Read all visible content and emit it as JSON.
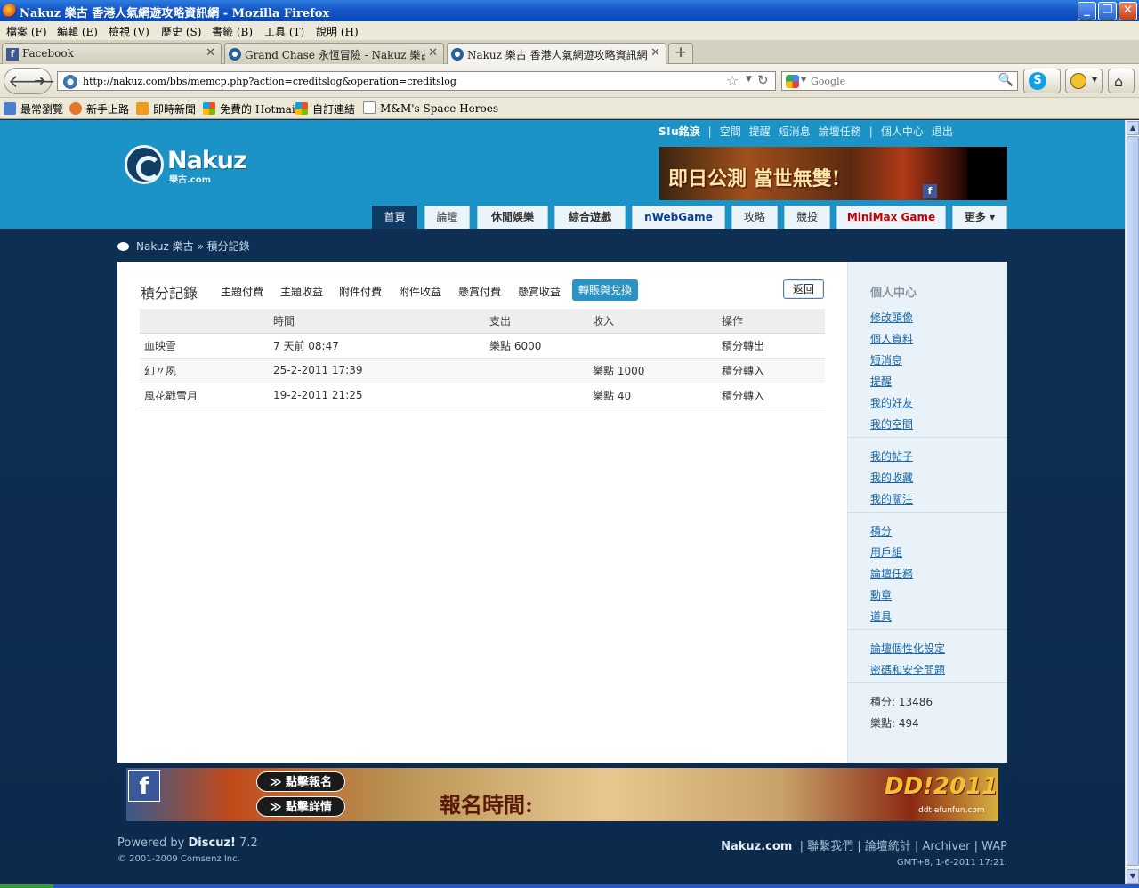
{
  "window": {
    "title": "Nakuz 樂古 香港人氣網遊攻略資訊網 - Mozilla Firefox",
    "controls": [
      "_",
      "❐",
      "✕"
    ]
  },
  "menubar": [
    "檔案 (F)",
    "編輯 (E)",
    "檢視 (V)",
    "歷史 (S)",
    "書籤 (B)",
    "工具 (T)",
    "說明 (H)"
  ],
  "tabs": [
    {
      "label": "Facebook",
      "icon": "facebook-icon",
      "active": false
    },
    {
      "label": "Grand Chase 永恆冒險 - Nakuz 樂古 香港人氣網遊攻略資訊網",
      "icon": "nakuz-icon",
      "active": false
    },
    {
      "label": "Nakuz 樂古 香港人氣網遊攻略資訊網",
      "icon": "nakuz-icon",
      "active": true
    }
  ],
  "navbar": {
    "url": "http://nakuz.com/bbs/memcp.php?action=creditslog&operation=creditslog",
    "search_placeholder": "Google"
  },
  "bookmarks": [
    "最常瀏覽",
    "新手上路",
    "即時新聞",
    "免費的 Hotmail",
    "自訂連結",
    "M&M's Space Heroes"
  ],
  "site": {
    "logo_text": "Nakuz",
    "logo_sub": "樂古.com",
    "top_links": {
      "user": "S!u銘淚",
      "items": [
        "空間",
        "提醒",
        "短消息",
        "論壇任務"
      ],
      "items2": [
        "個人中心",
        "退出"
      ]
    },
    "banner_top_text": "即日公測 當世無雙!",
    "nav": [
      "首頁",
      "論壇",
      "休閒娛樂",
      "綜合遊戲",
      "nWebGame",
      "攻略",
      "競投",
      "MiniMax Game",
      "更多 ▾"
    ],
    "breadcrumb": {
      "home": "Nakuz 樂古",
      "sep": "»",
      "current": "積分記錄"
    }
  },
  "main": {
    "heading": "積分記錄",
    "subtabs": [
      "主題付費",
      "主題收益",
      "附件付費",
      "附件收益",
      "懸賞付費",
      "懸賞收益",
      "轉賬與兌換"
    ],
    "active_subtab": "轉賬與兌換",
    "back_button": "返回",
    "table": {
      "headers": [
        "",
        "時間",
        "支出",
        "收入",
        "操作"
      ],
      "rows": [
        [
          "血映雪",
          "7 天前 08:47",
          "樂點 6000",
          "",
          "積分轉出"
        ],
        [
          "幻〃夙",
          "25-2-2011 17:39",
          "",
          "樂點 1000",
          "積分轉入"
        ],
        [
          "風花戳雪月",
          "19-2-2011 21:25",
          "",
          "樂點 40",
          "積分轉入"
        ]
      ]
    }
  },
  "sidebar": {
    "title": "個人中心",
    "group1": [
      "修改頭像",
      "個人資料",
      "短消息",
      "提醒",
      "我的好友",
      "我的空間"
    ],
    "group2": [
      "我的帖子",
      "我的收藏",
      "我的關注"
    ],
    "group3": [
      "積分",
      "用戶組",
      "論壇任務",
      "勳章",
      "道具"
    ],
    "group4": [
      "論壇個性化設定",
      "密碼和安全問題"
    ],
    "stats": [
      "積分: 13486",
      "樂點: 494"
    ]
  },
  "banner_bottom": {
    "btn1": "≫ 點擊報名",
    "btn2": "≫ 點擊詳情",
    "middle": "報名時間:",
    "right": "DD!2011",
    "url": "ddt.efunfun.com",
    "side_text": "f"
  },
  "footer": {
    "powered": "Powered by",
    "product": "Discuz!",
    "version": "7.2",
    "copyright": "© 2001-2009 Comsenz Inc.",
    "site": "Nakuz.com",
    "links": [
      "聯繫我們",
      "論壇統計",
      "Archiver",
      "WAP"
    ],
    "gmt": "GMT+8, 1-6-2011 17:21."
  },
  "colors": {
    "header": "#1b93c7",
    "page_bg": "#0e2f55",
    "active_subtab": "#2a93c4",
    "sidebar_bg": "#eaf2f9"
  }
}
